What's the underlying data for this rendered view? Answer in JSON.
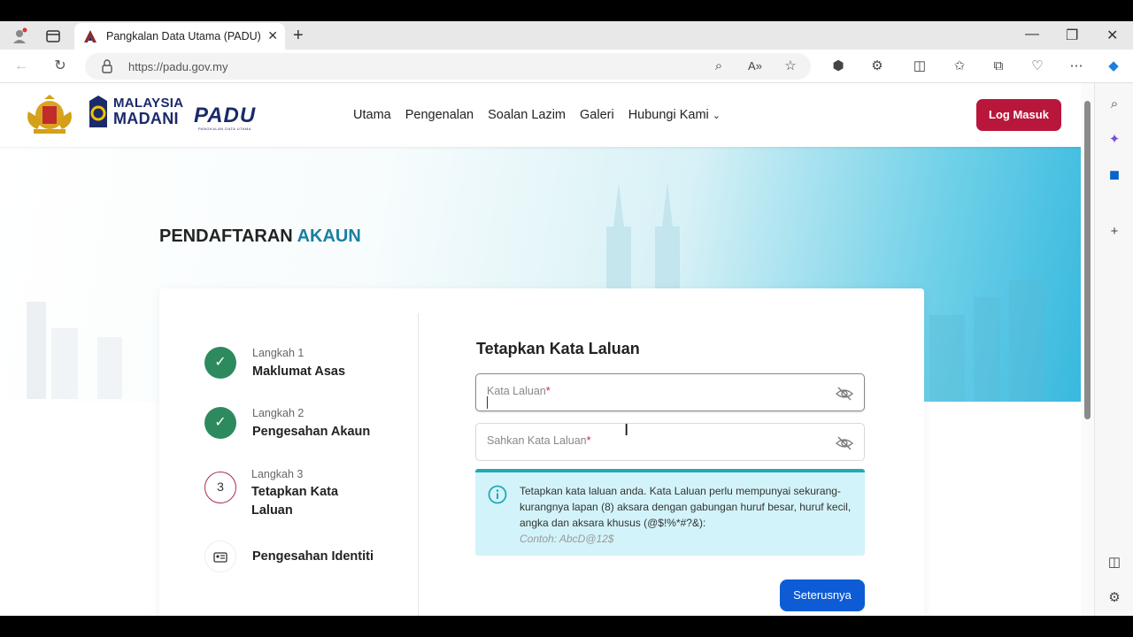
{
  "browser": {
    "tab_title": "Pangkalan Data Utama (PADU)",
    "tab_close": "✕",
    "new_tab": "+",
    "url": "https://padu.gov.my",
    "win_min": "—",
    "win_restore": "❐",
    "win_close": "✕"
  },
  "site": {
    "logo_madani_line1": "MALAYSIA",
    "logo_madani_line2": "MADANI",
    "logo_padu": "PADU",
    "logo_padu_sub": "PANGKALAN DATA UTAMA",
    "nav": [
      "Utama",
      "Pengenalan",
      "Soalan Lazim",
      "Galeri",
      "Hubungi Kami"
    ],
    "login": "Log Masuk"
  },
  "page": {
    "heading_main": "PENDAFTARAN",
    "heading_accent": "AKAUN"
  },
  "steps": [
    {
      "num": "Langkah 1",
      "name": "Maklumat Asas",
      "status": "done"
    },
    {
      "num": "Langkah 2",
      "name": "Pengesahan Akaun",
      "status": "done"
    },
    {
      "num": "Langkah 3",
      "name": "Tetapkan Kata Laluan",
      "status": "active",
      "marker": "3"
    },
    {
      "num": "",
      "name": "Pengesahan Identiti",
      "status": "pending"
    }
  ],
  "form": {
    "title": "Tetapkan Kata Laluan",
    "password_label": "Kata Laluan",
    "confirm_label": "Sahkan Kata Laluan",
    "required_mark": "*",
    "info_text": "Tetapkan kata laluan anda. Kata Laluan perlu mempunyai sekurang-kurangnya lapan (8) aksara dengan gabungan huruf besar, huruf kecil, angka dan aksara khusus (@$!%*#?&):",
    "info_example": "Contoh: AbcD@12$",
    "next": "Seterusnya"
  },
  "colors": {
    "login_button": "#b8173b",
    "accent": "#1a7fa0",
    "done_step": "#2d8a5e",
    "next_button": "#0d5cd6",
    "info_bg": "#d2f3f9"
  }
}
